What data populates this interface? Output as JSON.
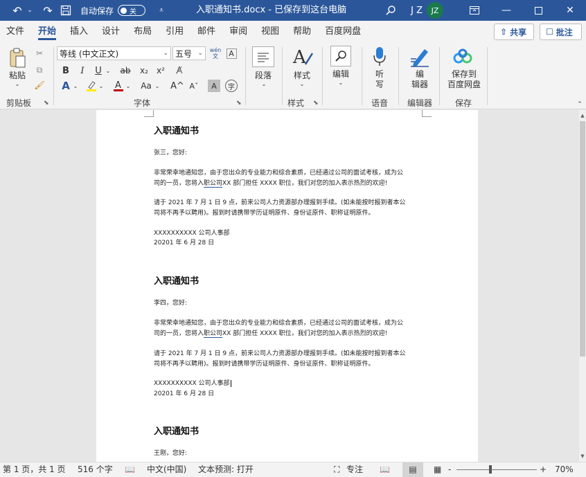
{
  "titlebar": {
    "autosave_label": "自动保存",
    "autosave_state": "关",
    "document_title": "入职通知书.docx - 已保存到这台电脑",
    "user_initials": "J Z",
    "avatar_text": "JZ",
    "accent_color": "#2b579a"
  },
  "tabs": [
    "文件",
    "开始",
    "插入",
    "设计",
    "布局",
    "引用",
    "邮件",
    "审阅",
    "视图",
    "帮助",
    "百度网盘"
  ],
  "active_tab": "开始",
  "share_label": "共享",
  "comment_label": "批注",
  "ribbon": {
    "clipboard": {
      "paste_label": "粘贴",
      "group_label": "剪贴板"
    },
    "font": {
      "font_name": "等线 (中文正文)",
      "font_size": "五号",
      "wen_label": "wén\n文",
      "group_label": "字体"
    },
    "paragraph": {
      "label": "段落"
    },
    "styles": {
      "label": "样式",
      "group_label": "样式"
    },
    "editing": {
      "label": "编辑"
    },
    "voice": {
      "label": "听\n写",
      "group_label": "语音"
    },
    "editor": {
      "label": "编\n辑器",
      "group_label": "编辑器"
    },
    "save": {
      "label": "保存到\n百度网盘",
      "group_label": "保存"
    }
  },
  "document": {
    "letters": [
      {
        "title": "入职通知书",
        "greeting": "张三，您好:",
        "para1_line1": "非常荣幸地通知您，由于您出众的专业能力和综合素质，已经通过公司的面试考核，成为公",
        "para1_line2_a": "司的一员，您将入",
        "para1_line2_u": "职公司",
        "para1_line2_b": "XX 部门担任 XXXX 职位，我们对您的加入表示热烈的欢迎!",
        "para2_line1": "请于 2021 年 7 月 1 日 9 点，前来公司人力资源部办理报到手续。(如未能按时报到者本公",
        "para2_line2": "司将不再予以聘用)。报到时请携带学历证明原件、身份证原件、职称证明原件。",
        "signature": "XXXXXXXXXX 公司人事部",
        "date": "20201 年 6 月 28 日"
      },
      {
        "title": "入职通知书",
        "greeting": "李四，您好:",
        "para1_line1": "非常荣幸地通知您，由于您出众的专业能力和综合素质，已经通过公司的面试考核，成为公",
        "para1_line2_a": "司的一员，您将入",
        "para1_line2_u": "职公司",
        "para1_line2_b": "XX 部门担任 XXXX 职位，我们对您的加入表示热烈的欢迎!",
        "para2_line1": "请于 2021 年 7 月 1 日 9 点，前来公司人力资源部办理报到手续。(如未能按时报到者本公",
        "para2_line2": "司将不再予以聘用)。报到时请携带学历证明原件、身份证原件、职称证明原件。",
        "signature": "XXXXXXXXXX 公司人事部",
        "date": "20201 年 6 月 28 日"
      },
      {
        "title": "入职通知书",
        "greeting": "王刚，您好:"
      }
    ]
  },
  "statusbar": {
    "page_info": "第 1 页，共 1 页",
    "word_count": "516 个字",
    "language": "中文(中国)",
    "text_prediction": "文本预测: 打开",
    "focus_label": "专注",
    "zoom_minus": "-",
    "zoom_plus": "+",
    "zoom_level": "70%"
  }
}
